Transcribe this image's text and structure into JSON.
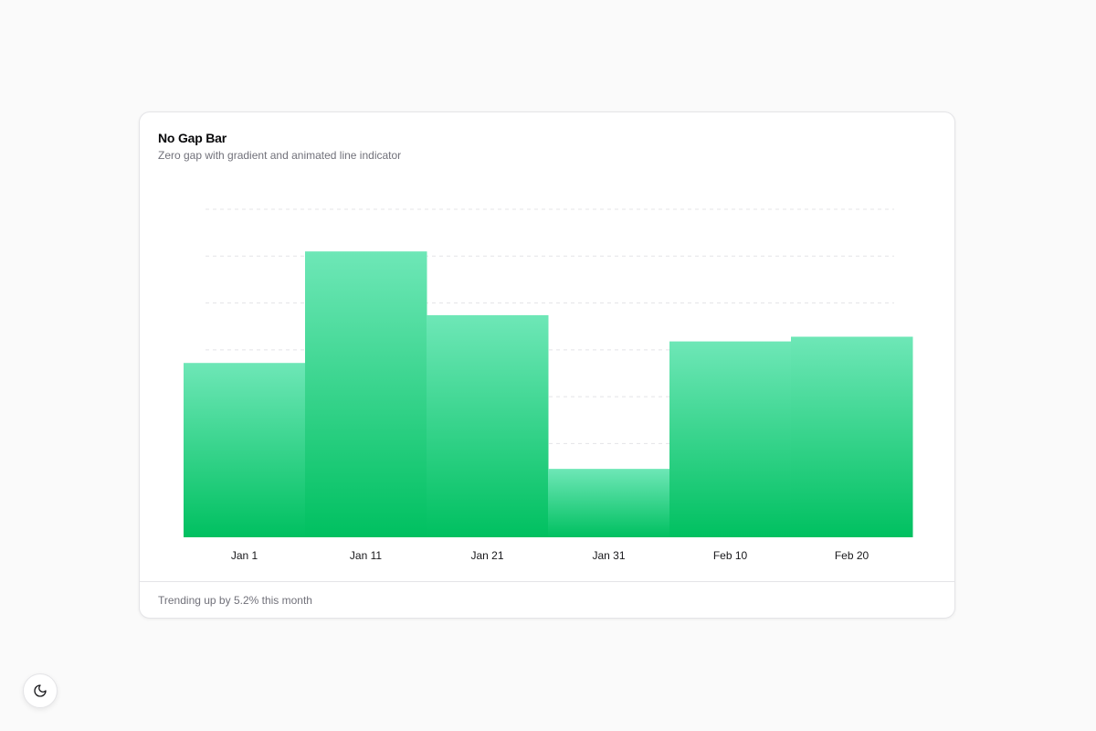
{
  "card": {
    "title": "No Gap Bar",
    "subtitle": "Zero gap with gradient and animated line indicator",
    "footer": "Trending up by 5.2% this month"
  },
  "theme_toggle": {
    "icon": "moon-icon"
  },
  "colors": {
    "bar_top": "#6ee7b7",
    "bar_bottom": "#00c060",
    "grid": "#e4e4e7"
  },
  "chart_data": {
    "type": "bar",
    "categories": [
      "Jan 1",
      "Jan 11",
      "Jan 21",
      "Jan 31",
      "Feb 10",
      "Feb 20"
    ],
    "values": [
      186,
      305,
      237,
      73,
      209,
      214
    ],
    "ylim": [
      0,
      350
    ],
    "grid": true,
    "xlabel": "",
    "ylabel": ""
  }
}
